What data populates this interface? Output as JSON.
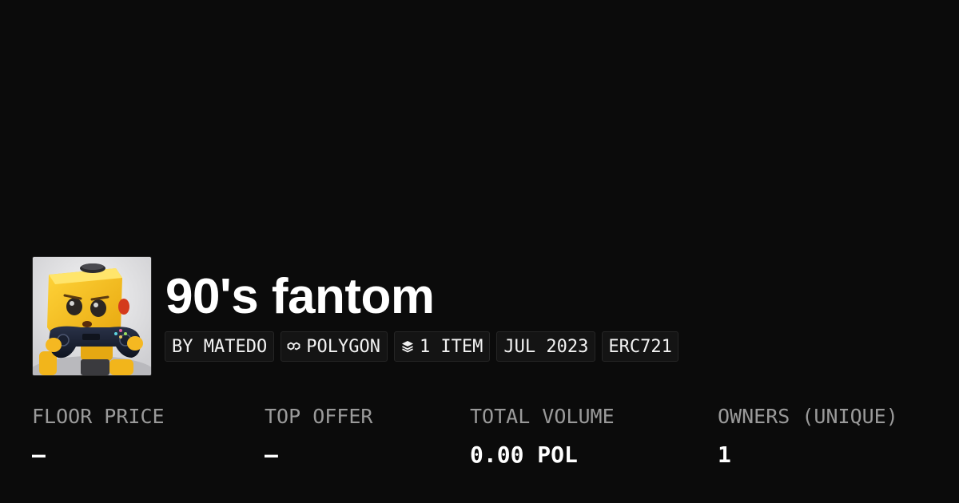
{
  "collection": {
    "name": "90's fantom",
    "avatar_icon": "game-controller-robot-avatar"
  },
  "chips": [
    {
      "label": "BY MATEDO",
      "icon": ""
    },
    {
      "label": "POLYGON",
      "icon": "polygon-icon"
    },
    {
      "label": "1 ITEM",
      "icon": "layers-icon"
    },
    {
      "label": "JUL 2023",
      "icon": ""
    },
    {
      "label": "ERC721",
      "icon": ""
    }
  ],
  "stats": [
    {
      "label": "FLOOR PRICE",
      "value": "–"
    },
    {
      "label": "TOP OFFER",
      "value": "–"
    },
    {
      "label": "TOTAL VOLUME",
      "value": "0.00 POL"
    },
    {
      "label": "OWNERS (UNIQUE)",
      "value": "1"
    }
  ],
  "colors": {
    "background": "#0b0b0b",
    "chip_background": "#141414",
    "label_gray": "#9a9a9a",
    "text": "#ffffff"
  }
}
